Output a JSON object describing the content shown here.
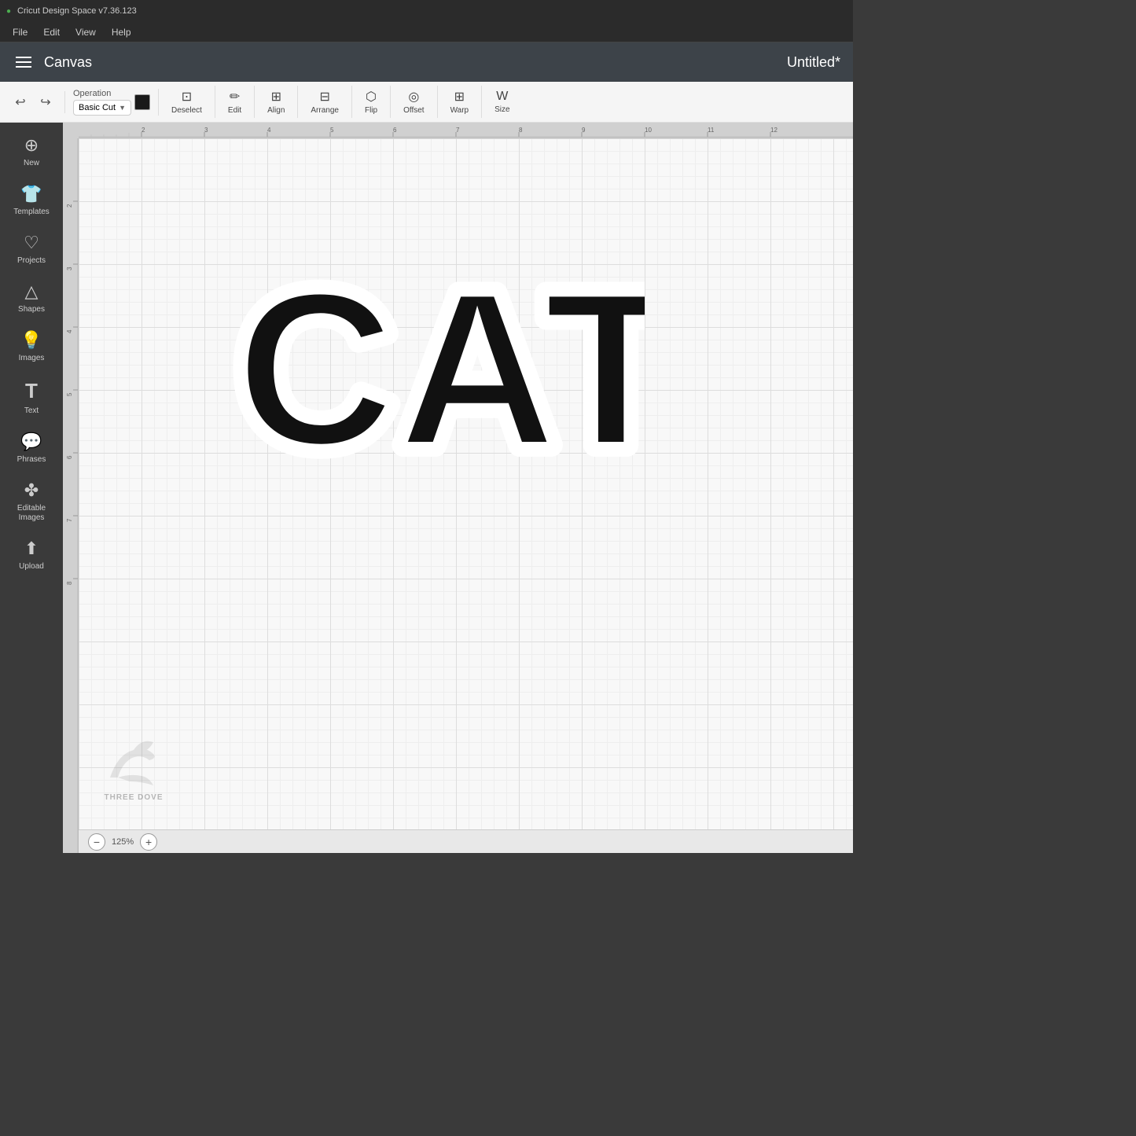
{
  "titleBar": {
    "logo": "●",
    "appName": "Cricut Design Space  v7.36.123"
  },
  "menuBar": {
    "items": [
      "File",
      "Edit",
      "View",
      "Help"
    ]
  },
  "header": {
    "hamburgerLabel": "menu",
    "title": "Canvas",
    "docTitle": "Untitled*"
  },
  "toolbar": {
    "historyBack": "↩",
    "historyForward": "↪",
    "operationLabel": "Operation",
    "operationValue": "Basic Cut",
    "colorSwatchColor": "#1a1a1a",
    "deselectLabel": "Deselect",
    "editLabel": "Edit",
    "alignLabel": "Align",
    "arrangeLabel": "Arrange",
    "flipLabel": "Flip",
    "offsetLabel": "Offset",
    "warpLabel": "Warp",
    "sizeLabel": "Size"
  },
  "sidebar": {
    "items": [
      {
        "id": "new",
        "icon": "⊕",
        "label": "New"
      },
      {
        "id": "templates",
        "icon": "👕",
        "label": "Templates"
      },
      {
        "id": "projects",
        "icon": "♡",
        "label": "Projects"
      },
      {
        "id": "shapes",
        "icon": "△",
        "label": "Shapes"
      },
      {
        "id": "images",
        "icon": "💡",
        "label": "Images"
      },
      {
        "id": "text",
        "icon": "T",
        "label": "Text"
      },
      {
        "id": "phrases",
        "icon": "☉",
        "label": "Phrases"
      },
      {
        "id": "editable-images",
        "icon": "✤",
        "label": "Editable Images"
      },
      {
        "id": "upload",
        "icon": "⬆",
        "label": "Upload"
      }
    ]
  },
  "canvas": {
    "rulerTopNumbers": [
      "2",
      "3",
      "4",
      "5",
      "6",
      "7",
      "8"
    ],
    "rulerLeftNumbers": [
      "2",
      "3",
      "4",
      "5",
      "6",
      "7"
    ],
    "catText": "CAT",
    "zoomLevel": "125%",
    "zoomDecrease": "−",
    "zoomIncrease": "+"
  },
  "watermark": {
    "line1": "THREE DOVE"
  }
}
